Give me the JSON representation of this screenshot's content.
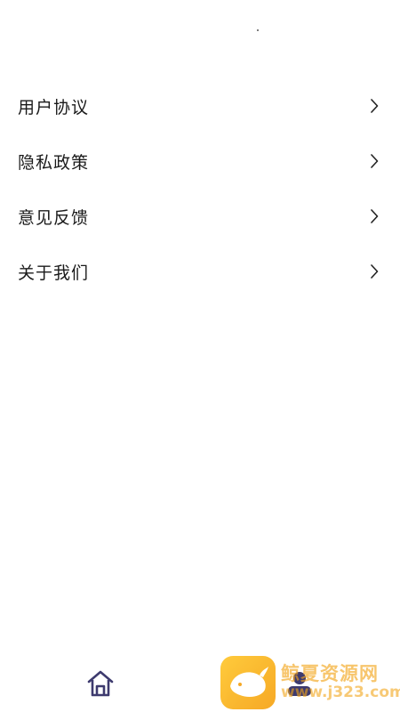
{
  "menu": {
    "items": [
      {
        "label": "用户协议",
        "icon": "chevron-right-icon"
      },
      {
        "label": "隐私政策",
        "icon": "chevron-right-icon"
      },
      {
        "label": "意见反馈",
        "icon": "chevron-right-icon"
      },
      {
        "label": "关于我们",
        "icon": "chevron-right-icon"
      }
    ]
  },
  "tabbar": {
    "tabs": [
      {
        "name": "home",
        "icon": "home-icon",
        "active": false
      },
      {
        "name": "mine",
        "icon": "profile-icon",
        "active": true
      }
    ],
    "accent_color": "#3d3a6e"
  },
  "watermark": {
    "title": "鲸夏资源网",
    "url": "www.j323.com",
    "color": "#f3a51a"
  }
}
